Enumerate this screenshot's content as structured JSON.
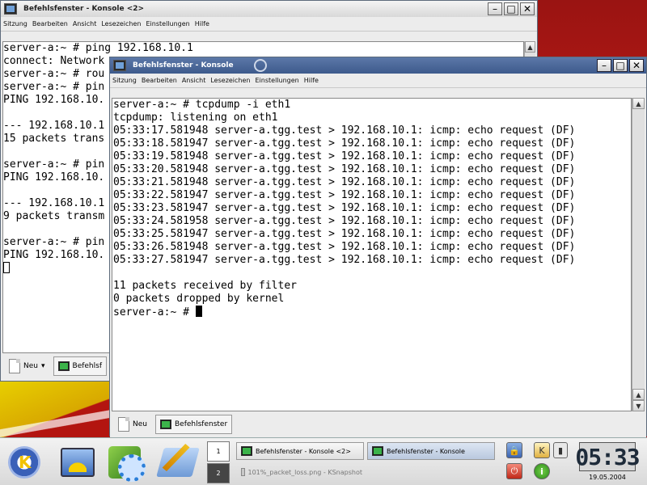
{
  "back_window": {
    "title": "Befehlsfenster - Konsole <2>",
    "menu": [
      "Sitzung",
      "Bearbeiten",
      "Ansicht",
      "Lesezeichen",
      "Einstellungen",
      "Hilfe"
    ],
    "lines": [
      "server-a:~ # ping 192.168.10.1",
      "connect: Network",
      "server-a:~ # rou",
      "server-a:~ # pin",
      "PING 192.168.10.",
      "",
      "--- 192.168.10.1",
      "15 packets trans",
      "",
      "server-a:~ # pin",
      "PING 192.168.10.",
      "",
      "--- 192.168.10.1",
      "9 packets transm",
      "",
      "server-a:~ # pin",
      "PING 192.168.10."
    ],
    "tab_new": "Neu",
    "tab_session": "Befehlsf"
  },
  "front_window": {
    "title": "Befehlsfenster - Konsole",
    "menu": [
      "Sitzung",
      "Bearbeiten",
      "Ansicht",
      "Lesezeichen",
      "Einstellungen",
      "Hilfe"
    ],
    "lines": [
      "server-a:~ # tcpdump -i eth1",
      "tcpdump: listening on eth1",
      "05:33:17.581948 server-a.tgg.test > 192.168.10.1: icmp: echo request (DF)",
      "05:33:18.581947 server-a.tgg.test > 192.168.10.1: icmp: echo request (DF)",
      "05:33:19.581948 server-a.tgg.test > 192.168.10.1: icmp: echo request (DF)",
      "05:33:20.581948 server-a.tgg.test > 192.168.10.1: icmp: echo request (DF)",
      "05:33:21.581948 server-a.tgg.test > 192.168.10.1: icmp: echo request (DF)",
      "05:33:22.581947 server-a.tgg.test > 192.168.10.1: icmp: echo request (DF)",
      "05:33:23.581947 server-a.tgg.test > 192.168.10.1: icmp: echo request (DF)",
      "05:33:24.581958 server-a.tgg.test > 192.168.10.1: icmp: echo request (DF)",
      "05:33:25.581947 server-a.tgg.test > 192.168.10.1: icmp: echo request (DF)",
      "05:33:26.581948 server-a.tgg.test > 192.168.10.1: icmp: echo request (DF)",
      "05:33:27.581947 server-a.tgg.test > 192.168.10.1: icmp: echo request (DF)",
      "",
      "11 packets received by filter",
      "0 packets dropped by kernel"
    ],
    "prompt": "server-a:~ # ",
    "tab_new": "Neu",
    "tab_session": "Befehlsfenster"
  },
  "taskbar": {
    "pager": [
      "1",
      "2"
    ],
    "tasks": [
      "Befehlsfenster - Konsole <2>",
      "Befehlsfenster - Konsole",
      "101%_packet_loss.png - KSnapshot"
    ],
    "clock": "05:33",
    "date": "19.05.2004"
  },
  "icons": {
    "k_menu": "kde-k-menu-icon",
    "desktop": "desktop-icon",
    "control_center": "control-center-icon",
    "editor": "kwrite-icon"
  }
}
